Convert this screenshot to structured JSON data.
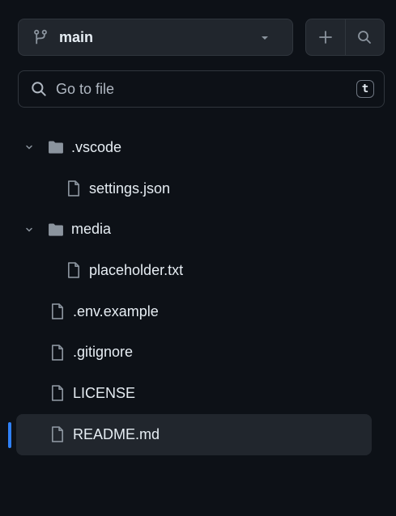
{
  "branch": {
    "name": "main"
  },
  "actions": {
    "add_icon": "plus-icon",
    "search_icon": "search-icon"
  },
  "search": {
    "placeholder": "Go to file",
    "shortcut": "t"
  },
  "tree": [
    {
      "label": ".vscode",
      "type": "folder",
      "expanded": true,
      "depth": 0
    },
    {
      "label": "settings.json",
      "type": "file",
      "depth": 1
    },
    {
      "label": "media",
      "type": "folder",
      "expanded": true,
      "depth": 0
    },
    {
      "label": "placeholder.txt",
      "type": "file",
      "depth": 1
    },
    {
      "label": ".env.example",
      "type": "file",
      "depth": 0
    },
    {
      "label": ".gitignore",
      "type": "file",
      "depth": 0
    },
    {
      "label": "LICENSE",
      "type": "file",
      "depth": 0
    },
    {
      "label": "README.md",
      "type": "file",
      "depth": 0,
      "selected": true
    }
  ],
  "colors": {
    "background": "#0d1117",
    "button": "#21262d",
    "border": "#30363d",
    "text": "#e6edf3",
    "muted": "#8b949e",
    "accent": "#2f81f7"
  }
}
